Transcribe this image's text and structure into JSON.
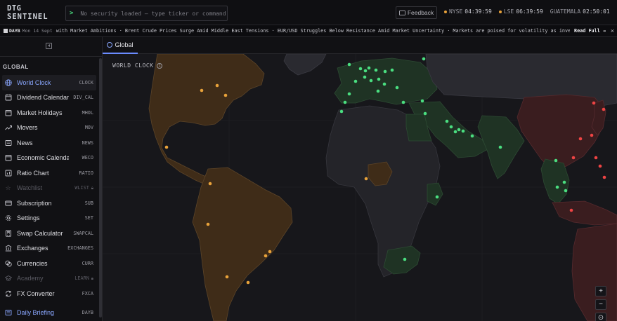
{
  "app": {
    "logo_line1": "DTG",
    "logo_line2": "SENTINEL"
  },
  "command": {
    "prompt": ">",
    "placeholder": "No security loaded — type ticker or command"
  },
  "header": {
    "feedback_label": "Feedback",
    "clocks": [
      {
        "tz": "NYSE",
        "time": "04:39:59"
      },
      {
        "tz": "LSE",
        "time": "06:39:59"
      },
      {
        "tz": "GUATEMALA",
        "time": "02:50:01"
      }
    ]
  },
  "ticker": {
    "tag": "DAYB",
    "date": "Mon 14 Sept",
    "text": "with Market Ambitions · Brent Crude Prices Surge Amid Middle East Tensions · EUR/USD Struggles Below Resistance Amid Market Uncertainty · Markets are poised for volatility as investors brace for the F",
    "read_full": "Read Full →",
    "close": "×"
  },
  "sidebar": {
    "section": "GLOBAL",
    "items": [
      {
        "label": "World Clock",
        "code": "CLOCK",
        "icon": "globe-icon"
      },
      {
        "label": "Dividend Calendar",
        "code": "DIV_CAL",
        "icon": "dollar-icon"
      },
      {
        "label": "Market Holidays",
        "code": "MHOL",
        "icon": "calendar-icon"
      },
      {
        "label": "Movers",
        "code": "MOV",
        "icon": "trend-icon"
      },
      {
        "label": "News",
        "code": "NEWS",
        "icon": "newspaper-icon"
      },
      {
        "label": "Economic Calendar",
        "code": "WECO",
        "icon": "calendar-icon"
      },
      {
        "label": "Ratio Chart",
        "code": "RATIO",
        "icon": "chart-icon"
      },
      {
        "label": "Watchlist",
        "code": "WLIST",
        "icon": "star-icon"
      },
      {
        "label": "Subscription",
        "code": "SUB",
        "icon": "card-icon"
      },
      {
        "label": "Settings",
        "code": "SET",
        "icon": "gear-icon"
      },
      {
        "label": "Swap Calculator",
        "code": "SWAPCAL",
        "icon": "calculator-icon"
      },
      {
        "label": "Exchanges",
        "code": "EXCHANGES",
        "icon": "building-icon"
      },
      {
        "label": "Currencies",
        "code": "CURR",
        "icon": "coins-icon"
      },
      {
        "label": "Academy",
        "code": "LEARN",
        "icon": "graduation-icon"
      },
      {
        "label": "FX Converter",
        "code": "FXCA",
        "icon": "exchange-icon"
      },
      {
        "label": "Daily Briefing",
        "code": "DAYB",
        "icon": "newspaper-icon"
      }
    ]
  },
  "main": {
    "tab_label": "Global",
    "map_title": "WORLD CLOCK",
    "zoom_in": "+",
    "zoom_out": "−",
    "locate": "⊙"
  },
  "colors": {
    "accent": "#8aa7ff",
    "market_open": "#4ade80",
    "market_premarket": "#e8a23a",
    "market_closed": "#ef4444"
  }
}
